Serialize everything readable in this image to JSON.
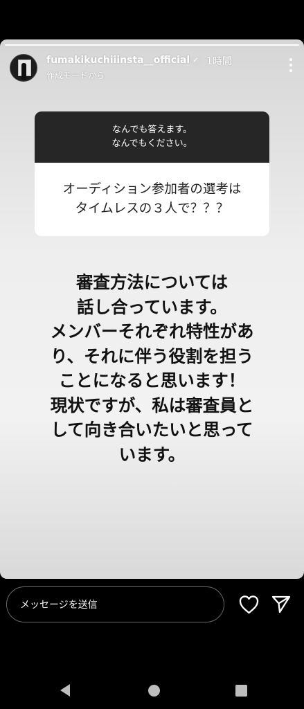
{
  "story": {
    "username": "fumakikuchiiinsta__official",
    "time": "1時間",
    "subtitle": "作成モードから",
    "verified_icon": "verified-badge-icon",
    "more_icon": "more-vertical-icon"
  },
  "question_box": {
    "prompt_line1": "なんでも答えます。",
    "prompt_line2": "なんでもください。",
    "question_line1": "オーディション参加者の選考は",
    "question_line2": "タイムレスの３人で？？？"
  },
  "answer": {
    "lines": [
      "審査方法については",
      "話し合っています。",
      "メンバーそれぞれ特性があ",
      "り、それに伴う役割を担う",
      "ことになると思います！",
      "現状ですが、私は審査員と",
      "して向き合いたいと思って",
      "います。"
    ]
  },
  "reply_bar": {
    "placeholder": "メッセージを送信",
    "like_icon": "heart-icon",
    "send_icon": "send-icon"
  },
  "navbar": {
    "back_icon": "back-triangle-icon",
    "home_icon": "home-circle-icon",
    "recent_icon": "recent-apps-icon"
  }
}
